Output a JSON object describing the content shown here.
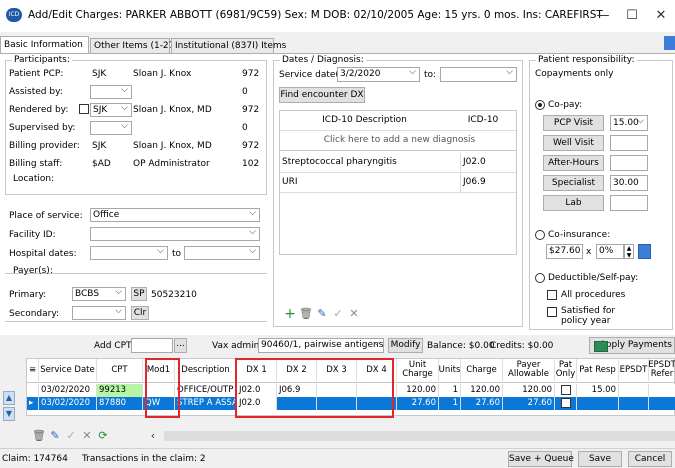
{
  "window": {
    "title": "Add/Edit Charges: PARKER ABBOTT (6981/9C59)  Sex: M  DOB: 02/10/2005  Age: 15 yrs. 0 mos.  Ins: CAREFIRST",
    "app_icon_text": "ICD",
    "minimize": "—",
    "maximize": "☐",
    "close": "✕"
  },
  "tabs": [
    "Basic Information",
    "Other Items (1-27)",
    "Institutional (837I) Items"
  ],
  "participants": {
    "legend": "Participants:",
    "rows": [
      {
        "label": "Patient PCP:",
        "code": "SJK",
        "name": "Sloan J. Knox",
        "num": "972"
      },
      {
        "label": "Assisted by:",
        "code": "",
        "name": "",
        "num": "0"
      },
      {
        "label": "Rendered by:",
        "code": "SJK",
        "name": "Sloan J. Knox, MD",
        "num": "972"
      },
      {
        "label": "Supervised by:",
        "code": "",
        "name": "",
        "num": "0"
      },
      {
        "label": "Billing provider:",
        "code": "SJK",
        "name": "Sloan J. Knox, MD",
        "num": "972"
      },
      {
        "label": "Billing staff:",
        "code": "$AD",
        "name": "OP Administrator",
        "num": "102"
      }
    ]
  },
  "location": {
    "legend": "Location:",
    "place_label": "Place of service:",
    "place_value": "Office",
    "facility_label": "Facility ID:",
    "facility_value": "",
    "hospital_label": "Hospital dates:",
    "to_label": "to"
  },
  "payers": {
    "legend": "Payer(s):",
    "primary_label": "Primary:",
    "primary_value": "BCBS",
    "primary_code": "SP",
    "primary_id": "50523210",
    "secondary_label": "Secondary:",
    "secondary_value": "",
    "clr": "Clr"
  },
  "dates": {
    "legend": "Dates / Diagnosis:",
    "service_label": "Service date(s):",
    "service_value": "3/2/2020",
    "to_label": "to:",
    "find_button": "Find encounter DX",
    "dx_header_desc": "ICD-10 Description",
    "dx_header_code": "ICD-10",
    "dx_add_hint": "Click here to add a new diagnosis",
    "dx_rows": [
      {
        "desc": "Streptococcal pharyngitis",
        "code": "J02.0"
      },
      {
        "desc": "URI",
        "code": "J06.9"
      }
    ]
  },
  "patient_resp": {
    "legend": "Patient responsibility:",
    "mode": "Copayments only",
    "copay_label": "Co-pay:",
    "pcp_visit": "PCP Visit",
    "pcp_value": "15.00",
    "well_visit": "Well Visit",
    "well_value": "",
    "after_hours": "After-Hours",
    "after_value": "",
    "specialist": "Specialist",
    "specialist_value": "30.00",
    "lab": "Lab",
    "lab_value": "",
    "coins_label": "Co-insurance:",
    "coins_amount": "$27.60",
    "coins_x": "x",
    "coins_pct": "0%",
    "deductible_label": "Deductible/Self-pay:",
    "all_procedures": "All procedures",
    "satisfied": "Satisfied for policy year"
  },
  "cpt_bar": {
    "add_cpt_label": "Add CPT:",
    "browse": "...",
    "vax_label": "Vax admin:",
    "vax_value": "90460/1, pairwise antigens",
    "modify": "Modify",
    "balance": "Balance: $0.00",
    "credits": "Credits: $0.00",
    "apply": "Apply Payments"
  },
  "charges_grid": {
    "headers": [
      "Service Date",
      "CPT",
      "Mod1",
      "Description",
      "DX 1",
      "DX 2",
      "DX 3",
      "DX 4",
      "Unit Charge",
      "Units",
      "Charge",
      "Payer Allowable",
      "Pat Only",
      "Pat Resp",
      "EPSDT",
      "EPSDT Refer"
    ],
    "rows": [
      {
        "date": "03/02/2020",
        "cpt": "99213",
        "mod1": "",
        "desc": "OFFICE/OUTP",
        "dx1": "J02.0",
        "dx2": "J06.9",
        "dx3": "",
        "dx4": "",
        "unit_charge": "120.00",
        "units": "1",
        "charge": "120.00",
        "allowable": "120.00",
        "pat_resp": "15.00"
      },
      {
        "date": "03/02/2020",
        "cpt": "87880",
        "mod1": "QW",
        "desc": "STREP A ASSA",
        "dx1": "J02.0",
        "dx2": "",
        "dx3": "",
        "dx4": "",
        "unit_charge": "27.60",
        "units": "1",
        "charge": "27.60",
        "allowable": "27.60",
        "pat_resp": ""
      }
    ]
  },
  "status": {
    "claim": "Claim: 174764",
    "transactions": "Transactions in the claim: 2",
    "save_queue": "Save + Queue",
    "save": "Save",
    "cancel": "Cancel"
  },
  "colors": {
    "selected_row": "#0b78d7",
    "accent_red": "#e0262e",
    "cpt_green": "#b7f5a6"
  }
}
